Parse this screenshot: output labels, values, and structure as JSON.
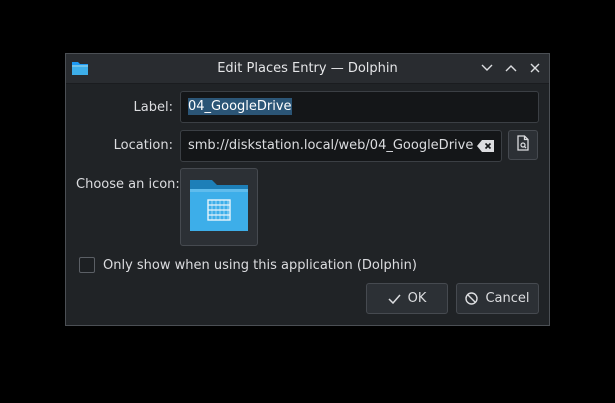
{
  "window": {
    "title": "Edit Places Entry — Dolphin",
    "icon": "folder-blue-icon",
    "controls": [
      "minimize-icon",
      "maximize-icon",
      "close-icon"
    ]
  },
  "form": {
    "label_text": "Label:",
    "label_value": "04_GoogleDrive",
    "location_text": "Location:",
    "location_value": "smb://diskstation.local/web/04_GoogleDrive",
    "icon_text": "Choose an icon:",
    "icon_name": "folder-remote-icon"
  },
  "options": {
    "only_this_app_label": "Only show when using this application (Dolphin)",
    "only_this_app_checked": false
  },
  "buttons": {
    "ok_label": "OK",
    "cancel_label": "Cancel"
  },
  "colors": {
    "accent": "#3daee9",
    "selection": "#2b5576",
    "window_bg": "#202326"
  }
}
